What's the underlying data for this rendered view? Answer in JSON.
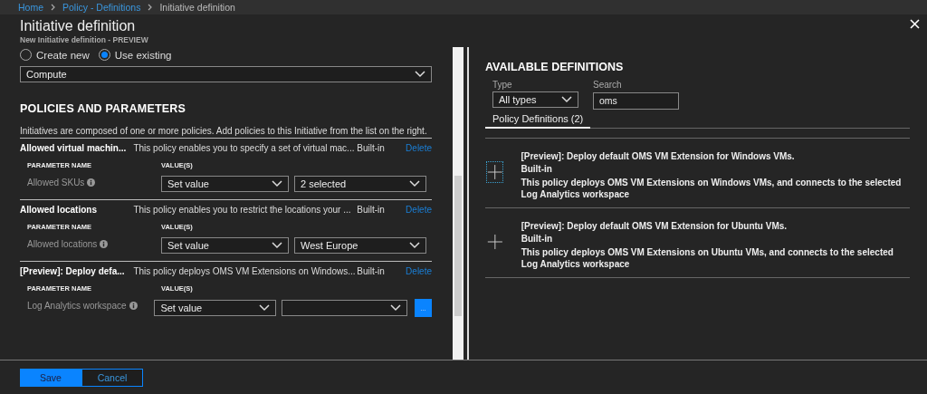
{
  "breadcrumb": [
    {
      "label": "Home",
      "link": true
    },
    {
      "label": "Policy - Definitions",
      "link": true
    },
    {
      "label": "Initiative definition",
      "link": false
    }
  ],
  "blade": {
    "title": "Initiative definition",
    "subtitle": "New Initiative definition - PREVIEW"
  },
  "category_mode": [
    {
      "label": "Create new",
      "selected": false
    },
    {
      "label": "Use existing",
      "selected": true
    }
  ],
  "category": {
    "value": "Compute"
  },
  "policies_section": {
    "heading": "POLICIES AND PARAMETERS",
    "description": "Initiatives are composed of one or more policies. Add policies to this Initiative from the list on the right."
  },
  "policies": [
    {
      "name": "Allowed virtual machin...",
      "description": "This policy enables you to specify a set of virtual mac...",
      "type": "Built-in",
      "action": "Delete",
      "param_header": "PARAMETER NAME",
      "value_header": "VALUE(S)",
      "params": [
        {
          "name": "Allowed SKUs",
          "mode": "Set value",
          "value": "2 selected"
        }
      ]
    },
    {
      "name": "Allowed locations",
      "description": "This policy enables you to restrict the locations your ...",
      "type": "Built-in",
      "action": "Delete",
      "param_header": "PARAMETER NAME",
      "value_header": "VALUE(S)",
      "params": [
        {
          "name": "Allowed locations",
          "mode": "Set value",
          "value": "West Europe"
        }
      ]
    },
    {
      "name": "[Preview]: Deploy defa...",
      "description": "This policy deploys OMS VM Extensions on Windows...",
      "type": "Built-in",
      "action": "Delete",
      "param_header": "PARAMETER NAME",
      "value_header": "VALUE(S)",
      "params": [
        {
          "name": "Log Analytics workspace",
          "mode": "Set value",
          "browse": "..."
        }
      ]
    }
  ],
  "available": {
    "heading": "AVAILABLE DEFINITIONS",
    "type_label": "Type",
    "type_value": "All types",
    "search_label": "Search",
    "search_value": "oms",
    "tabs": [
      {
        "label": "Policy Definitions (2)",
        "selected": true
      }
    ],
    "items": [
      {
        "title": "[Preview]: Deploy default OMS VM Extension for Windows VMs.",
        "type": "Built-in",
        "description": "This policy deploys OMS VM Extensions on Windows VMs, and connects to the selected Log Analytics workspace",
        "focused": true
      },
      {
        "title": "[Preview]: Deploy default OMS VM Extension for Ubuntu VMs.",
        "type": "Built-in",
        "description": "This policy deploys OMS VM Extensions on Ubuntu VMs, and connects to the selected Log Analytics workspace",
        "focused": false
      }
    ]
  },
  "footer": [
    {
      "label": "Save",
      "kind": "primary"
    },
    {
      "label": "Cancel",
      "kind": "secondary"
    }
  ]
}
